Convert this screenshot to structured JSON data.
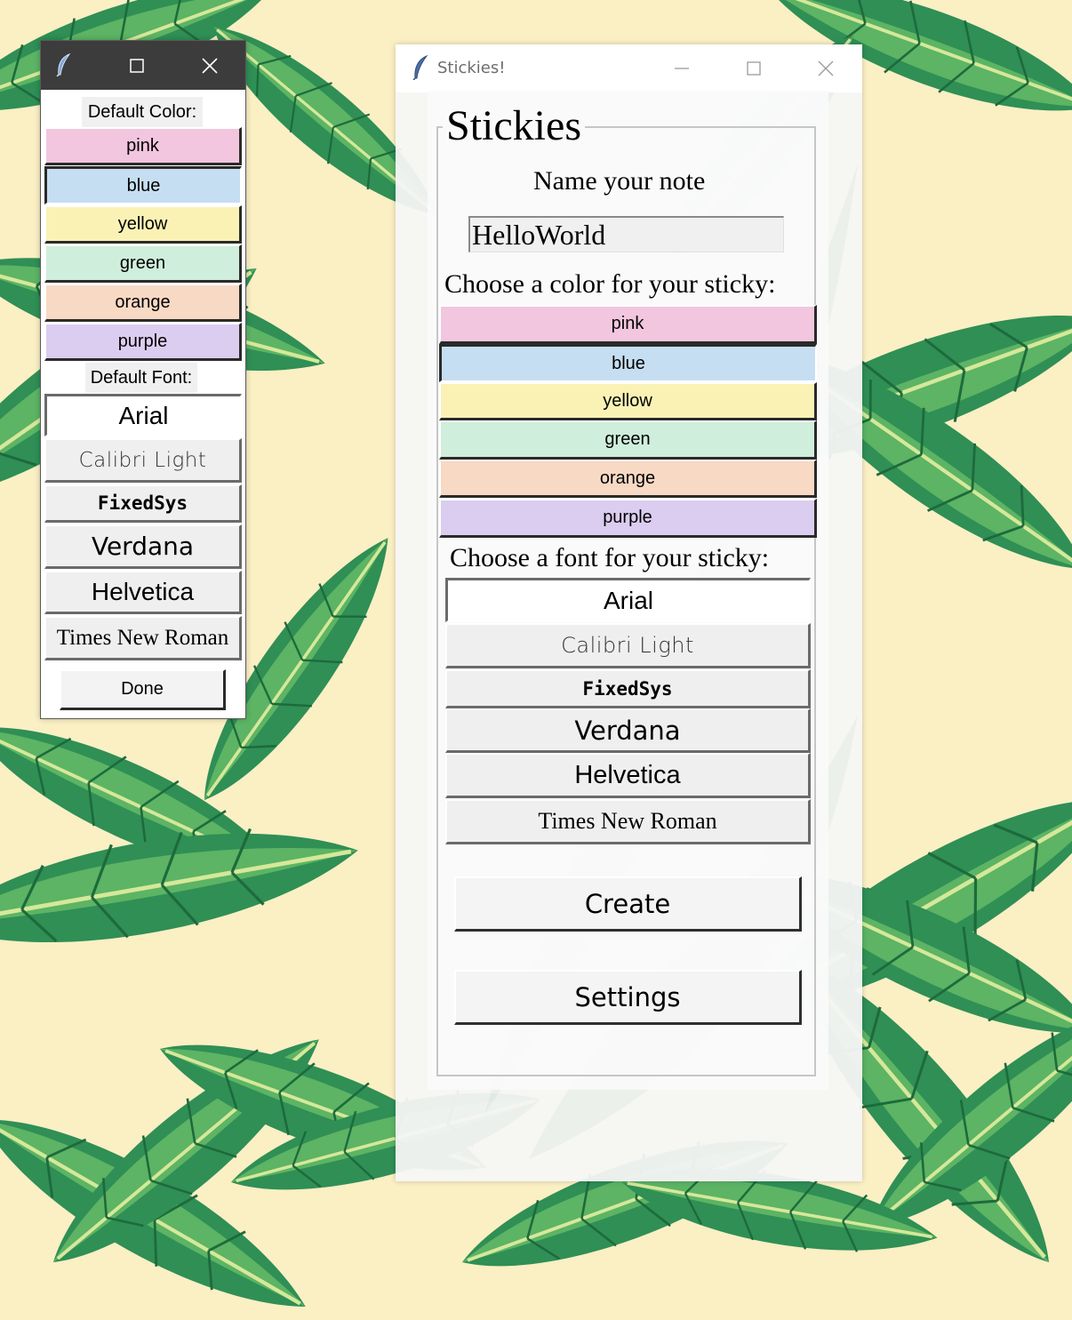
{
  "colors": {
    "pink": "#f2c6de",
    "blue": "#c6def1",
    "yellow": "#faf2b5",
    "green": "#cfeedb",
    "orange": "#f8d9c4",
    "purple": "#dbcdf0",
    "wallpaper": "#fbefc4"
  },
  "settings_window": {
    "app_icon": "feather-icon",
    "default_color_label": "Default Color:",
    "colors": [
      {
        "label": "pink",
        "color": "#f2c6de"
      },
      {
        "label": "blue",
        "color": "#c6def1",
        "selected": true
      },
      {
        "label": "yellow",
        "color": "#faf2b5"
      },
      {
        "label": "green",
        "color": "#cfeedb"
      },
      {
        "label": "orange",
        "color": "#f8d9c4"
      },
      {
        "label": "purple",
        "color": "#dbcdf0"
      }
    ],
    "default_font_label": "Default Font:",
    "fonts": [
      {
        "label": "Arial",
        "selected": true
      },
      {
        "label": "Calibri Light"
      },
      {
        "label": "FixedSys"
      },
      {
        "label": "Verdana"
      },
      {
        "label": "Helvetica"
      },
      {
        "label": "Times New Roman"
      }
    ],
    "done_label": "Done"
  },
  "main_window": {
    "title": "Stickies!",
    "app_icon": "feather-icon",
    "frame_title": "Stickies",
    "name_label": "Name your note",
    "name_value": "HelloWorld",
    "color_label": "Choose a color for your sticky:",
    "colors": [
      {
        "label": "pink",
        "color": "#f2c6de"
      },
      {
        "label": "blue",
        "color": "#c6def1",
        "selected": true
      },
      {
        "label": "yellow",
        "color": "#faf2b5"
      },
      {
        "label": "green",
        "color": "#cfeedb"
      },
      {
        "label": "orange",
        "color": "#f8d9c4"
      },
      {
        "label": "purple",
        "color": "#dbcdf0"
      }
    ],
    "font_label": "Choose a font for your sticky:",
    "fonts": [
      {
        "label": "Arial",
        "selected": true
      },
      {
        "label": "Calibri Light"
      },
      {
        "label": "FixedSys"
      },
      {
        "label": "Verdana"
      },
      {
        "label": "Helvetica"
      },
      {
        "label": "Times New Roman"
      }
    ],
    "create_label": "Create",
    "settings_label": "Settings"
  }
}
